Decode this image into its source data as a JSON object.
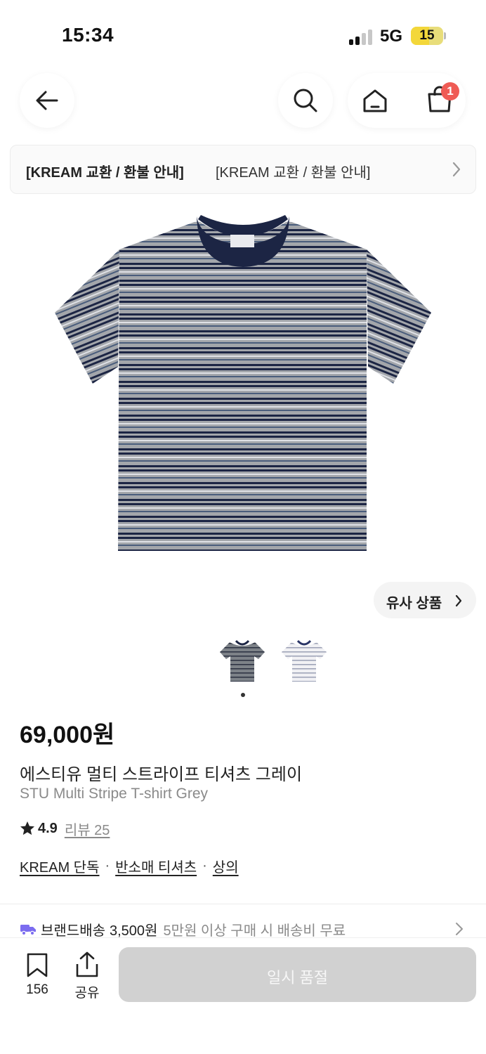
{
  "status_bar": {
    "time": "15:34",
    "network": "5G",
    "battery_level": "15",
    "battery_color": "#f3d73a"
  },
  "nav": {
    "back_icon": "arrow-left-icon",
    "search_icon": "search-icon",
    "home_icon": "home-icon",
    "cart_icon": "shopping-bag-icon",
    "cart_badge": "1",
    "badge_color": "#ef5b55"
  },
  "notice": {
    "bold_text": "[KREAM 교환 / 환불 안내]",
    "text": "[KREAM 교환 / 환불 안내]",
    "icon": "chevron-right-icon"
  },
  "product": {
    "image_icon": "striped-t-shirt-image",
    "similar_label": "유사 상품",
    "price": "69,000원",
    "name_ko": "에스티유 멀티 스트라이프 티셔츠 그레이",
    "name_en": "STU Multi Stripe T-shirt Grey",
    "rating": "4.9",
    "review_label": "리뷰 25",
    "categories": [
      "KREAM 단독",
      "반소매 티셔츠",
      "상의"
    ],
    "category_separator": "·"
  },
  "shipping": {
    "label": "브랜드배송",
    "fee": "3,500원",
    "note": "5만원 이상 구매 시 배송비 무료",
    "icon": "truck-icon",
    "icon_color": "#7b6cf0"
  },
  "bottom_bar": {
    "bookmark_count": "156",
    "share_label": "공유",
    "soldout_label": "일시 품절",
    "soldout_color": "#d1d1d1"
  }
}
